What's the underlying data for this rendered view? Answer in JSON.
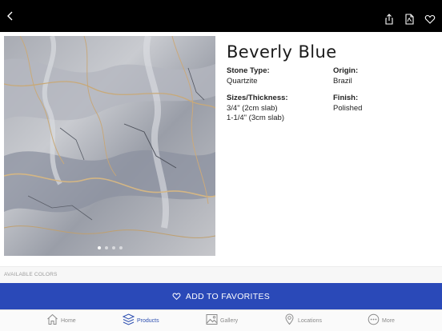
{
  "product": {
    "name": "Beverly Blue",
    "specs": [
      {
        "label": "Stone Type:",
        "lines": [
          "Quartzite"
        ]
      },
      {
        "label": "Origin:",
        "lines": [
          "Brazil"
        ]
      },
      {
        "label": "Sizes/Thickness:",
        "lines": [
          "3/4\" (2cm slab)",
          "1-1/4\" (3cm slab)"
        ]
      },
      {
        "label": "Finish:",
        "lines": [
          "Polished"
        ]
      }
    ],
    "image_count": 4,
    "active_image": 1
  },
  "available_colors_label": "AVAILABLE COLORS",
  "favorites_button": "ADD TO FAVORITES",
  "tabs": [
    {
      "label": "Home",
      "icon": "home-icon"
    },
    {
      "label": "Products",
      "icon": "products-icon"
    },
    {
      "label": "Gallery",
      "icon": "gallery-icon"
    },
    {
      "label": "Locations",
      "icon": "location-pin-icon"
    },
    {
      "label": "More",
      "icon": "more-icon"
    }
  ],
  "active_tab": "Products",
  "colors": {
    "accent": "#2a49b8",
    "topbar": "#000000",
    "active_tab": "#2d4fb0"
  }
}
